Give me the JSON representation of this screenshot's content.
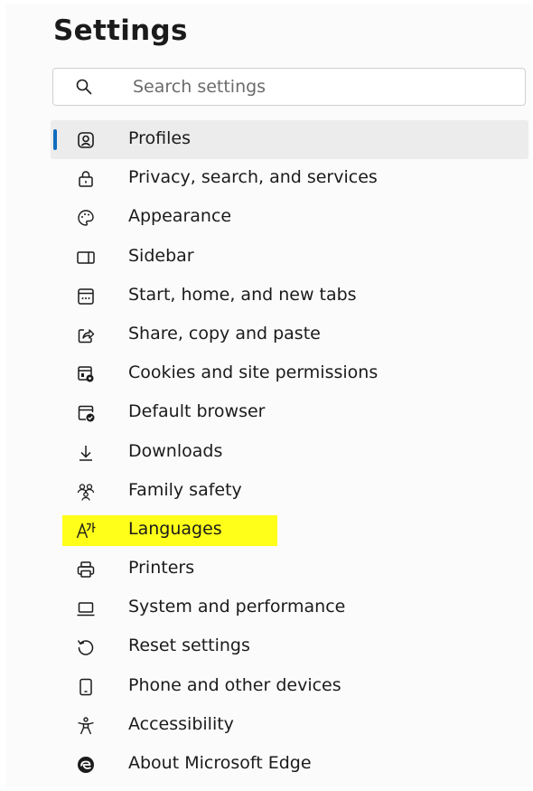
{
  "page": {
    "title": "Settings"
  },
  "search": {
    "placeholder": "Search settings",
    "value": ""
  },
  "nav": {
    "items": [
      {
        "label": "Profiles",
        "icon": "profile-icon",
        "active": true
      },
      {
        "label": "Privacy, search, and services",
        "icon": "lock-icon"
      },
      {
        "label": "Appearance",
        "icon": "palette-icon"
      },
      {
        "label": "Sidebar",
        "icon": "sidebar-icon"
      },
      {
        "label": "Start, home, and new tabs",
        "icon": "new-tab-icon"
      },
      {
        "label": "Share, copy and paste",
        "icon": "share-icon"
      },
      {
        "label": "Cookies and site permissions",
        "icon": "cookies-icon"
      },
      {
        "label": "Default browser",
        "icon": "default-browser-icon"
      },
      {
        "label": "Downloads",
        "icon": "download-icon"
      },
      {
        "label": "Family safety",
        "icon": "family-icon"
      },
      {
        "label": "Languages",
        "icon": "languages-icon",
        "highlighted": true
      },
      {
        "label": "Printers",
        "icon": "printer-icon"
      },
      {
        "label": "System and performance",
        "icon": "laptop-icon"
      },
      {
        "label": "Reset settings",
        "icon": "reset-icon"
      },
      {
        "label": "Phone and other devices",
        "icon": "phone-icon"
      },
      {
        "label": "Accessibility",
        "icon": "accessibility-icon"
      },
      {
        "label": "About Microsoft Edge",
        "icon": "edge-logo-icon"
      }
    ]
  },
  "colors": {
    "accent": "#0f6cbd",
    "highlight": "#ffff1a",
    "active_bg": "#ececec"
  }
}
